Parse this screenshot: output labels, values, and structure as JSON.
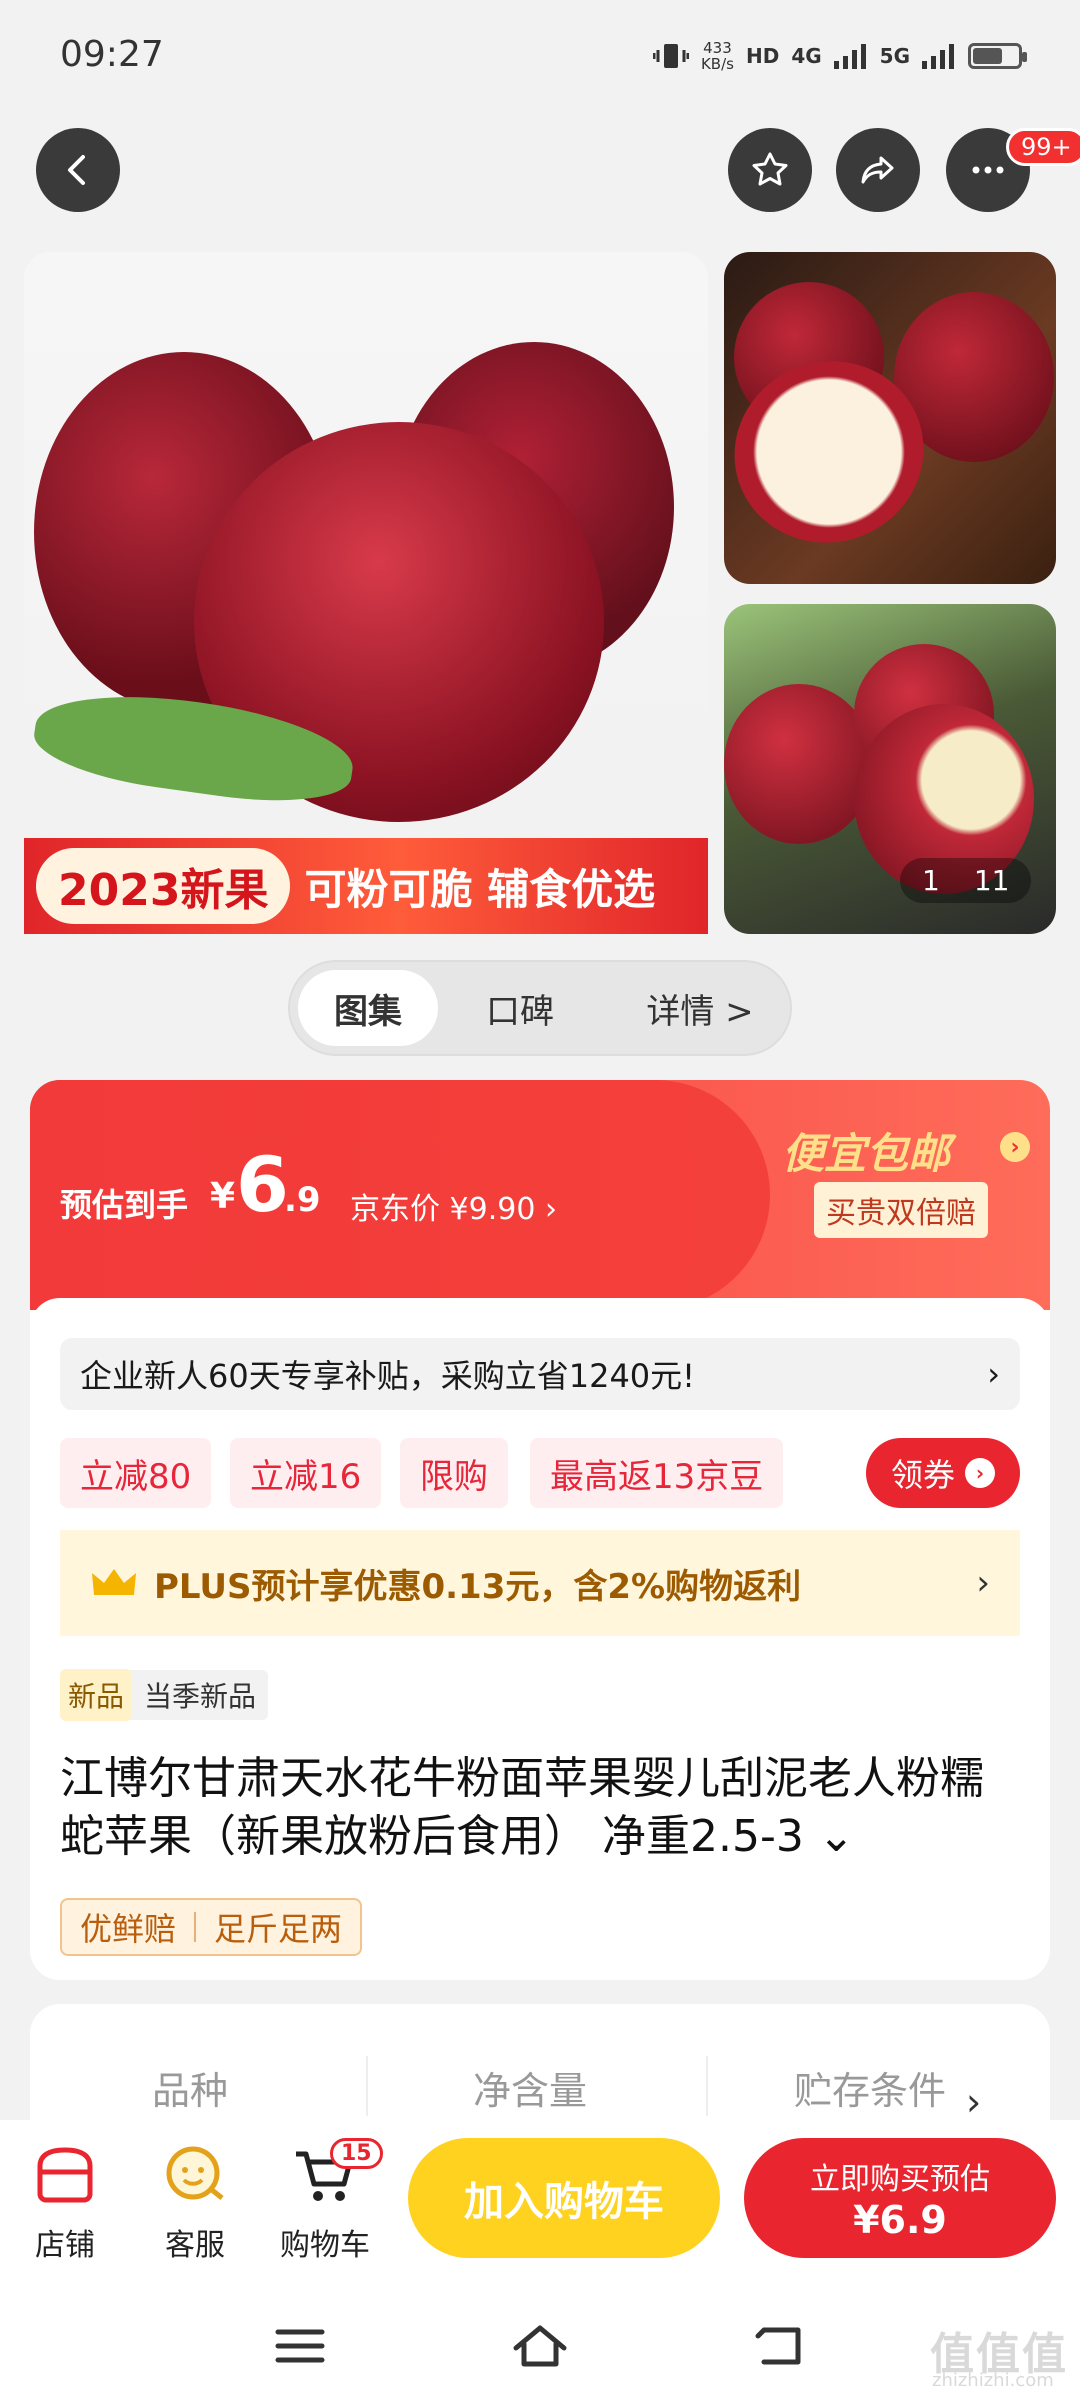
{
  "status_bar": {
    "time": "09:27",
    "net_speed_value": "433",
    "net_speed_unit": "KB/s",
    "sim1": "HD",
    "sig1": "4G",
    "sig2": "5G"
  },
  "header": {
    "badge": "99+"
  },
  "gallery": {
    "banner_year": "2023新果",
    "banner_slogan": "可粉可脆 辅食优选",
    "counter_current": "1",
    "counter_total": "11"
  },
  "tabs": [
    {
      "label": "图集"
    },
    {
      "label": "口碑"
    },
    {
      "label": "详情 >"
    }
  ],
  "price": {
    "est_label": "预估到手",
    "yen": "¥",
    "integer": "6",
    "decimal": ".9",
    "jd_price": "京东价 ¥9.90 ›",
    "cheap_shipping": "便宜包邮",
    "double_refund": "买贵双倍赔"
  },
  "promo": {
    "new_user": "企业新人60天专享补贴，采购立省1240元!",
    "chips": [
      "立减80",
      "立减16",
      "限购",
      "最高返13京豆"
    ],
    "coupon": "领券",
    "plus": "PLUS预计享优惠0.13元，含2%购物返利"
  },
  "product": {
    "season_tag": "新品",
    "season_text": "当季新品",
    "title": "江博尔甘肃天水花牛粉面苹果婴儿刮泥老人粉糯蛇苹果（新果放粉后食用） 净重2.5-3",
    "guarantees": [
      "优鲜赔",
      "足斤足两"
    ]
  },
  "specs": [
    "品种",
    "净含量",
    "贮存条件"
  ],
  "bottom_bar": {
    "shop": "店铺",
    "service": "客服",
    "cart": "购物车",
    "cart_count": "15",
    "add_to_cart": "加入购物车",
    "buy_label": "立即购买预估",
    "buy_price": "¥6.9"
  },
  "watermark": {
    "text": "值值值",
    "sub": "zhizhizhi.com"
  },
  "colors": {
    "accent": "#e9252f",
    "yellow": "#ffd21f",
    "gold": "#ffe08a"
  }
}
